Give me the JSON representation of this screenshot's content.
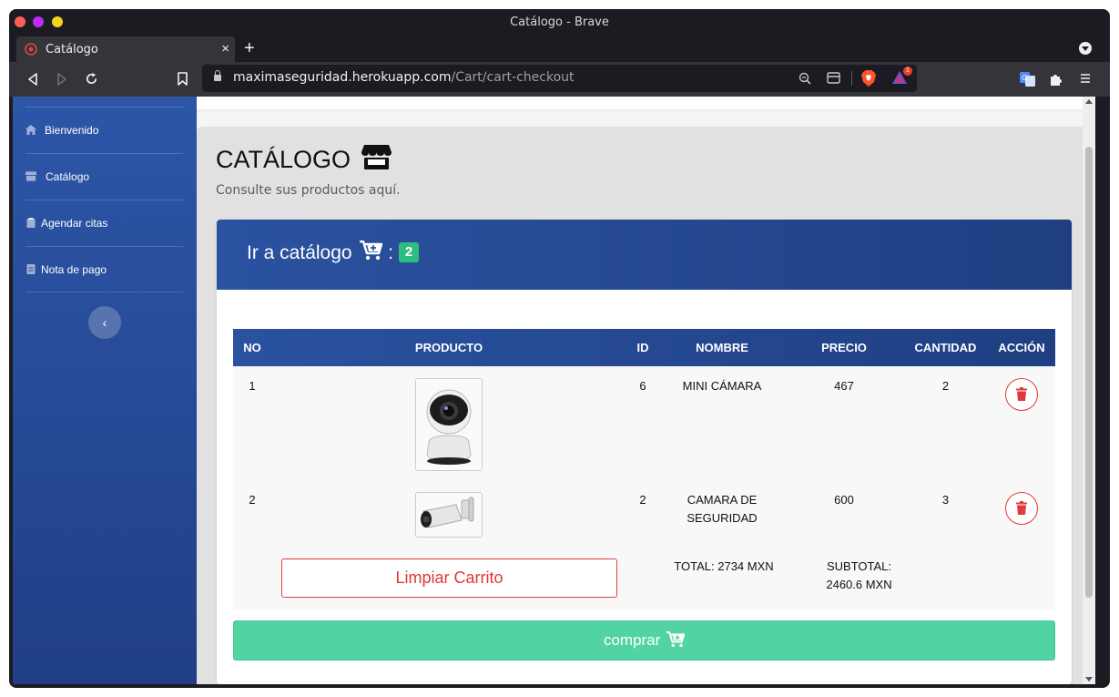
{
  "browser": {
    "window_title": "Catálogo - Brave",
    "tab_title": "Catálogo",
    "url_host": "maximaseguridad.herokuapp.com",
    "url_path": "/Cart/cart-checkout",
    "new_tab_symbol": "+",
    "close_tab_symbol": "×",
    "shield_badge_count": "1"
  },
  "sidebar": {
    "items": [
      {
        "label": "Bienvenido",
        "icon": "home-icon"
      },
      {
        "label": "Catálogo",
        "icon": "store-icon"
      },
      {
        "label": "Agendar citas",
        "icon": "clipboard-icon"
      },
      {
        "label": "Nota de pago",
        "icon": "receipt-icon"
      }
    ],
    "toggle_symbol": "‹"
  },
  "main": {
    "title": "CATÁLOGO",
    "subtitle": "Consulte sus productos aquí.",
    "card": {
      "header_text": "Ir a catálogo",
      "separator": ":",
      "cart_count": "2"
    },
    "table": {
      "headers": [
        "NO",
        "PRODUCTO",
        "ID",
        "NOMBRE",
        "PRECIO",
        "CANTIDAD",
        "ACCIÓN"
      ],
      "rows": [
        {
          "no": "1",
          "product_image": "mini-camera",
          "id": "6",
          "nombre": "MINI CÁMARA",
          "precio": "467",
          "cantidad": "2"
        },
        {
          "no": "2",
          "product_image": "bullet-camera",
          "id": "2",
          "nombre": "CAMARA DE SEGURIDAD",
          "precio": "600",
          "cantidad": "3"
        }
      ]
    },
    "clear_cart_label": "Limpiar Carrito",
    "total_text": "TOTAL: 2734 MXN",
    "subtotal_text": "SUBTOTAL: 2460.6 MXN",
    "buy_label": "comprar"
  },
  "colors": {
    "sidebar_top": "#2d56a8",
    "sidebar_bottom": "#203f86",
    "header_blue": "#2b52a0",
    "badge_green": "#2dbd7e",
    "buy_green": "#52d3a2",
    "danger_red": "#e03535"
  }
}
